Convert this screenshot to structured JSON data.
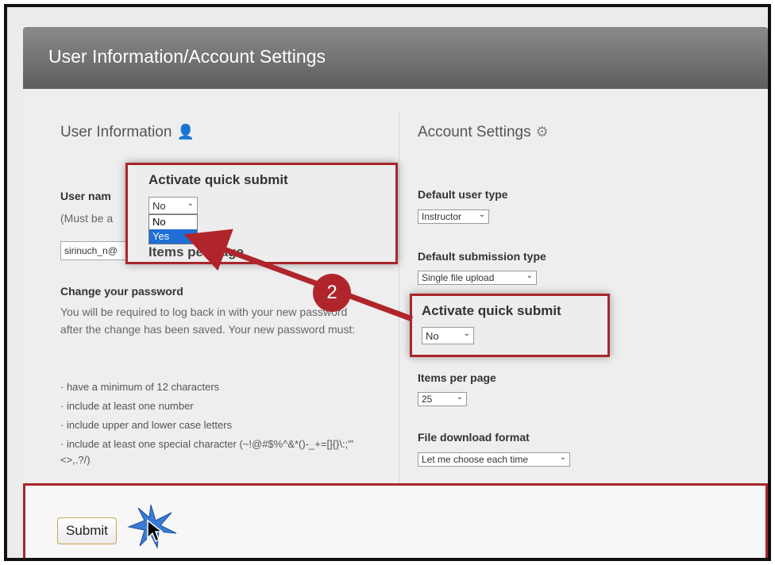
{
  "header": {
    "title": "User Information/Account Settings"
  },
  "left": {
    "section_title": "User Information",
    "section_icon": "user-icon",
    "username_label_partial": "User nam",
    "username_hint_partial": "(Must be a",
    "username_value_partial": "sirinuch_n@",
    "change_password_label": "Change your password",
    "password_help": "You will be required to log back in with your new password after the change has been saved. Your new password must:",
    "rules": [
      "have a minimum of 12 characters",
      "include at least one number",
      "include upper and lower case letters",
      "include at least one special character (~!@#$%^&*()-_+=[]{}\\:;'\"<>,.?/)"
    ]
  },
  "right": {
    "section_title": "Account Settings",
    "section_icon": "gear-icon",
    "default_user_type_label": "Default user type",
    "default_user_type_value": "Instructor",
    "default_submission_type_label": "Default submission type",
    "default_submission_type_value": "Single file upload",
    "activate_quick_submit_label": "Activate quick submit",
    "activate_quick_submit_value": "No",
    "items_per_page_label": "Items per page",
    "items_per_page_value": "25",
    "file_download_format_label": "File download format",
    "file_download_format_value": "Let me choose each time"
  },
  "zoom_callout": {
    "title": "Activate quick submit",
    "selected_value": "No",
    "options": [
      "No",
      "Yes"
    ],
    "behind_text": "Items per page"
  },
  "annotation": {
    "step_number": "2",
    "accent_color": "#a8262b"
  },
  "footer": {
    "submit_label": "Submit"
  }
}
